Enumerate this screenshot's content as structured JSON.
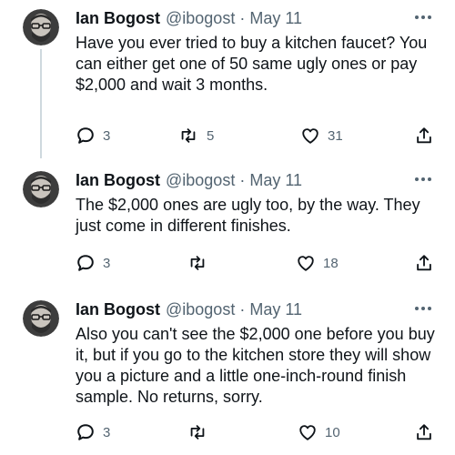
{
  "tweets": [
    {
      "name": "Ian Bogost",
      "handle": "@ibogost",
      "separator": "·",
      "date": "May 11",
      "text": "Have you ever tried to buy a kitchen faucet? You can either get one of 50 same ugly ones or pay $2,000 and wait 3 months.",
      "replies": "3",
      "retweets": "5",
      "likes": "31"
    },
    {
      "name": "Ian Bogost",
      "handle": "@ibogost",
      "separator": "·",
      "date": "May 11",
      "text": "The $2,000 ones are ugly too, by the way. They just come in different finishes.",
      "replies": "3",
      "retweets": "",
      "likes": "18"
    },
    {
      "name": "Ian Bogost",
      "handle": "@ibogost",
      "separator": "·",
      "date": "May 11",
      "text": "Also you can't see the $2,000 one before you buy it, but if you go to the kitchen store they will show you a picture and a little one-inch-round finish sample. No returns, sorry.",
      "replies": "3",
      "retweets": "",
      "likes": "10"
    }
  ],
  "icons": {
    "more": "more-icon",
    "reply": "reply-icon",
    "retweet": "retweet-icon",
    "like": "like-icon",
    "share": "share-icon",
    "avatar": "avatar"
  },
  "colors": {
    "text": "#0f1419",
    "secondary": "#536471",
    "thread_line": "#cfd9de",
    "background": "#ffffff"
  }
}
